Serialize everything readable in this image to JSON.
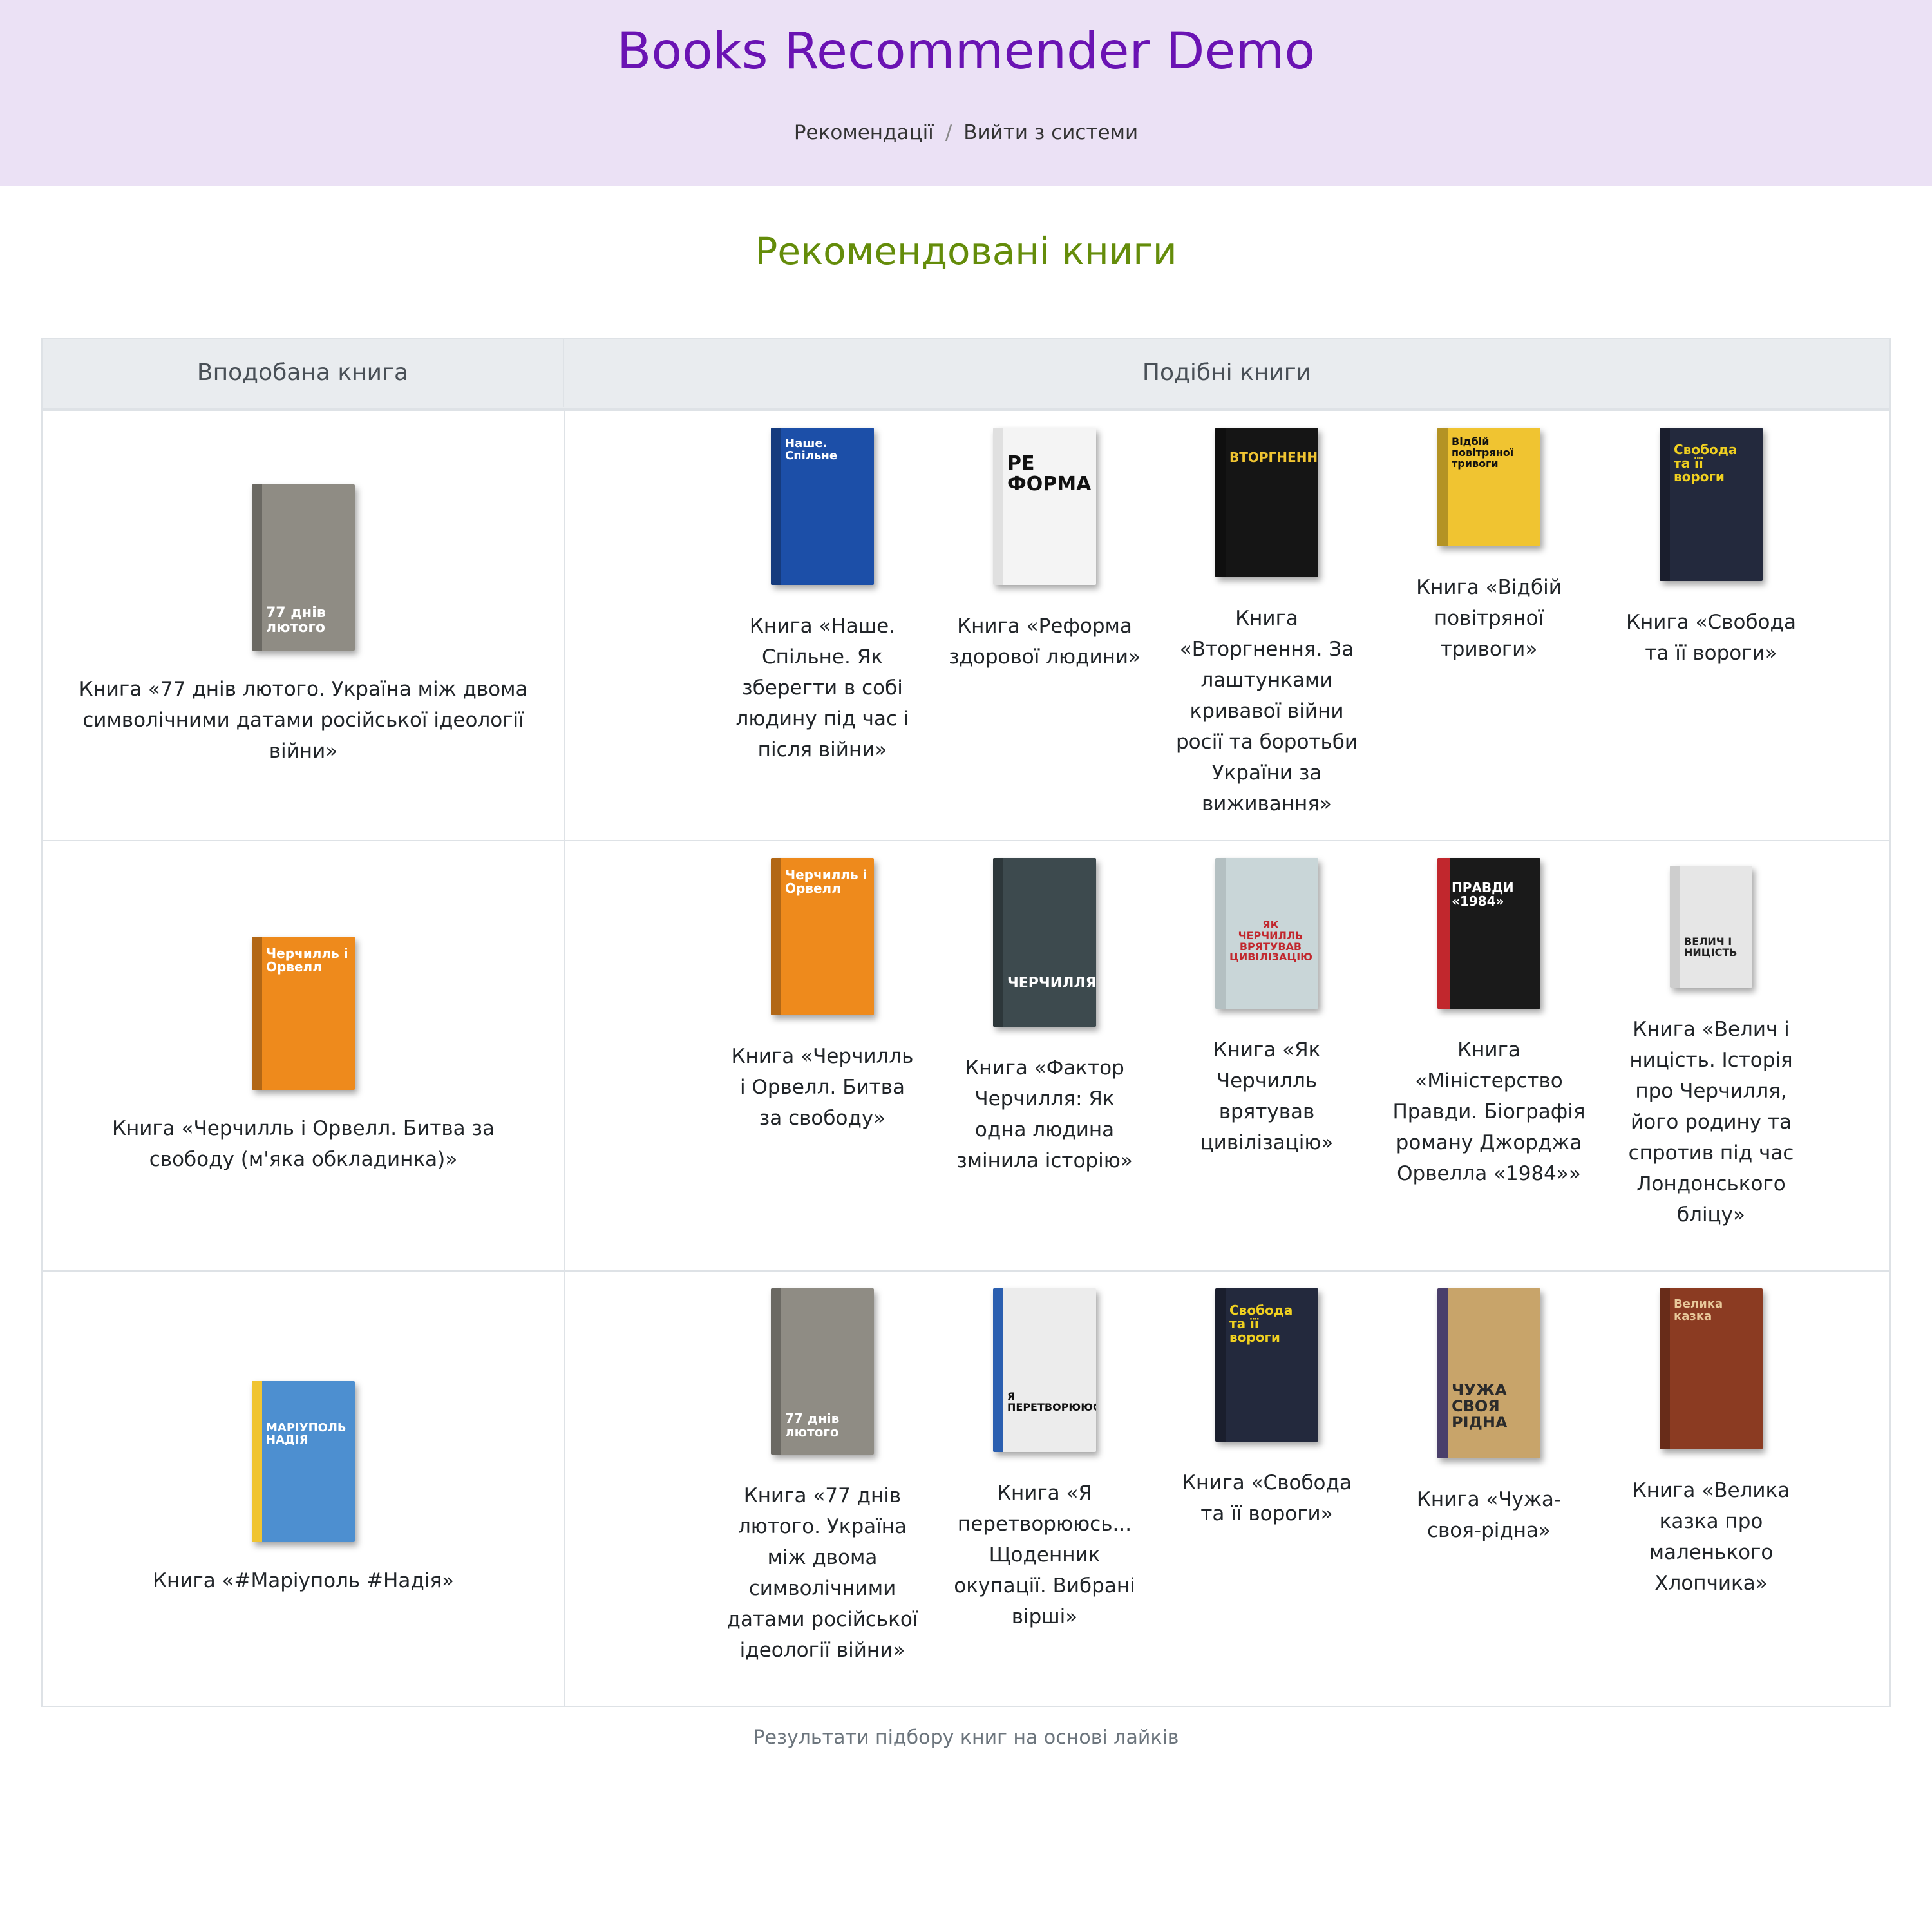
{
  "app": {
    "title": "Books Recommender Demo"
  },
  "nav": {
    "recommendations": "Рекомендації",
    "separator": "/",
    "logout": "Вийти з системи"
  },
  "page": {
    "title": "Рекомендовані книги"
  },
  "table": {
    "col_liked": "Вподобана книга",
    "col_similar": "Подібні книги"
  },
  "rows": [
    {
      "liked": {
        "caption": "Книга «77 днів лютого. Україна між двома символічними датами російської ідеології війни»",
        "cover_text": "77 днів лютого",
        "color": "#8f8c84"
      },
      "similar": [
        {
          "caption": "Книга «Наше. Спільне. Як зберегти в собі людину під час і після війни»",
          "cover_text": "Наше. Спільне",
          "color": "#1c4fa8"
        },
        {
          "caption": "Книга «Реформа здорової людини»",
          "cover_text": "РЕ ФОРМА",
          "color": "#f4f4f4"
        },
        {
          "caption": "Книга «Вторгнення. За лаштунками кривавої війни росії та боротьби України за виживання»",
          "cover_text": "ВТОРГНЕННЯ",
          "color": "#151515"
        },
        {
          "caption": "Книга «Відбій повітряної тривоги»",
          "cover_text": "Відбій повітряної тривоги",
          "color": "#f0c431"
        },
        {
          "caption": "Книга «Свобода та її вороги»",
          "cover_text": "Свобода та її вороги",
          "color": "#23293d"
        }
      ]
    },
    {
      "liked": {
        "caption": "Книга «Черчилль і Орвелл. Битва за свободу (м'яка обкладинка)»",
        "cover_text": "Черчилль і Орвелл",
        "color": "#ee8a1c"
      },
      "similar": [
        {
          "caption": "Книга «Черчилль і Орвелл. Битва за свободу»",
          "cover_text": "Черчилль і Орвелл",
          "color": "#ee8a1c"
        },
        {
          "caption": "Книга «Фактор Черчилля: Як одна людина змінила історію»",
          "cover_text": "ЧЕРЧИЛЛЯ",
          "color": "#3d4a4e"
        },
        {
          "caption": "Книга «Як Черчилль врятував цивілізацію»",
          "cover_text": "ЯК ЧЕРЧИЛЛЬ ВРЯТУВАВ ЦИВІЛІЗАЦІЮ",
          "color": "#c9d6d8"
        },
        {
          "caption": "Книга «Міністерство Правди. Біографія роману Джорджа Орвелла «1984»»",
          "cover_text": "ПРАВДИ «1984»",
          "color": "#1a1a1a"
        },
        {
          "caption": "Книга «Велич і ницість. Історія про Черчилля, його родину та спротив під час Лондонського бліцу»",
          "cover_text": "ВЕЛИЧ І НИЦІСТЬ",
          "color": "#e6e6e6"
        }
      ]
    },
    {
      "liked": {
        "caption": "Книга «#Маріуполь #Надія»",
        "cover_text": "МАРІУПОЛЬ НАДІЯ",
        "color": "#4d8fd0"
      },
      "similar": [
        {
          "caption": "Книга «77 днів лютого. Україна між двома символічними датами російської ідеології війни»",
          "cover_text": "77 днів лютого",
          "color": "#8f8c84"
        },
        {
          "caption": "Книга «Я перетворююсь... Щоденник окупації. Вибрані вірші»",
          "cover_text": "Я ПЕРЕТВОРЮЮСЬ",
          "color": "#ececec"
        },
        {
          "caption": "Книга «Свобода та її вороги»",
          "cover_text": "Свобода та її вороги",
          "color": "#23293d"
        },
        {
          "caption": "Книга «Чужа-своя-рідна»",
          "cover_text": "ЧУЖА СВОЯ РІДНА",
          "color": "#c8a46a"
        },
        {
          "caption": "Книга «Велика казка про маленького Хлопчика»",
          "cover_text": "Велика казка",
          "color": "#8b3b22"
        }
      ]
    }
  ],
  "footer": {
    "note": "Результати підбору книг на основі лайків"
  }
}
